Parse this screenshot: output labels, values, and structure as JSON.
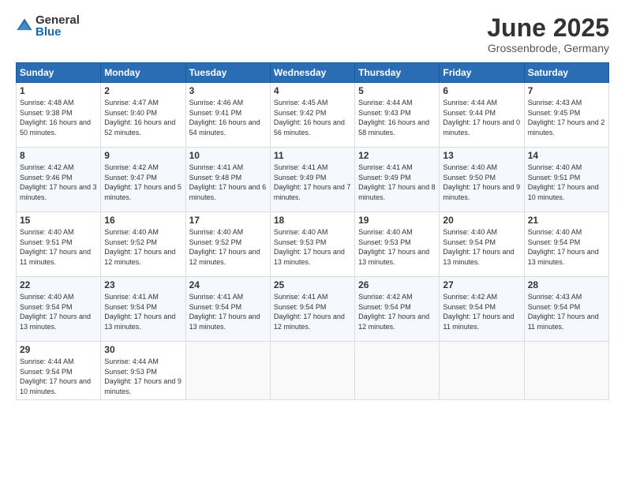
{
  "logo": {
    "general": "General",
    "blue": "Blue"
  },
  "title": "June 2025",
  "location": "Grossenbrode, Germany",
  "days": [
    "Sunday",
    "Monday",
    "Tuesday",
    "Wednesday",
    "Thursday",
    "Friday",
    "Saturday"
  ],
  "weeks": [
    [
      {
        "day": "1",
        "sunrise": "Sunrise: 4:48 AM",
        "sunset": "Sunset: 9:38 PM",
        "daylight": "Daylight: 16 hours and 50 minutes."
      },
      {
        "day": "2",
        "sunrise": "Sunrise: 4:47 AM",
        "sunset": "Sunset: 9:40 PM",
        "daylight": "Daylight: 16 hours and 52 minutes."
      },
      {
        "day": "3",
        "sunrise": "Sunrise: 4:46 AM",
        "sunset": "Sunset: 9:41 PM",
        "daylight": "Daylight: 16 hours and 54 minutes."
      },
      {
        "day": "4",
        "sunrise": "Sunrise: 4:45 AM",
        "sunset": "Sunset: 9:42 PM",
        "daylight": "Daylight: 16 hours and 56 minutes."
      },
      {
        "day": "5",
        "sunrise": "Sunrise: 4:44 AM",
        "sunset": "Sunset: 9:43 PM",
        "daylight": "Daylight: 16 hours and 58 minutes."
      },
      {
        "day": "6",
        "sunrise": "Sunrise: 4:44 AM",
        "sunset": "Sunset: 9:44 PM",
        "daylight": "Daylight: 17 hours and 0 minutes."
      },
      {
        "day": "7",
        "sunrise": "Sunrise: 4:43 AM",
        "sunset": "Sunset: 9:45 PM",
        "daylight": "Daylight: 17 hours and 2 minutes."
      }
    ],
    [
      {
        "day": "8",
        "sunrise": "Sunrise: 4:42 AM",
        "sunset": "Sunset: 9:46 PM",
        "daylight": "Daylight: 17 hours and 3 minutes."
      },
      {
        "day": "9",
        "sunrise": "Sunrise: 4:42 AM",
        "sunset": "Sunset: 9:47 PM",
        "daylight": "Daylight: 17 hours and 5 minutes."
      },
      {
        "day": "10",
        "sunrise": "Sunrise: 4:41 AM",
        "sunset": "Sunset: 9:48 PM",
        "daylight": "Daylight: 17 hours and 6 minutes."
      },
      {
        "day": "11",
        "sunrise": "Sunrise: 4:41 AM",
        "sunset": "Sunset: 9:49 PM",
        "daylight": "Daylight: 17 hours and 7 minutes."
      },
      {
        "day": "12",
        "sunrise": "Sunrise: 4:41 AM",
        "sunset": "Sunset: 9:49 PM",
        "daylight": "Daylight: 17 hours and 8 minutes."
      },
      {
        "day": "13",
        "sunrise": "Sunrise: 4:40 AM",
        "sunset": "Sunset: 9:50 PM",
        "daylight": "Daylight: 17 hours and 9 minutes."
      },
      {
        "day": "14",
        "sunrise": "Sunrise: 4:40 AM",
        "sunset": "Sunset: 9:51 PM",
        "daylight": "Daylight: 17 hours and 10 minutes."
      }
    ],
    [
      {
        "day": "15",
        "sunrise": "Sunrise: 4:40 AM",
        "sunset": "Sunset: 9:51 PM",
        "daylight": "Daylight: 17 hours and 11 minutes."
      },
      {
        "day": "16",
        "sunrise": "Sunrise: 4:40 AM",
        "sunset": "Sunset: 9:52 PM",
        "daylight": "Daylight: 17 hours and 12 minutes."
      },
      {
        "day": "17",
        "sunrise": "Sunrise: 4:40 AM",
        "sunset": "Sunset: 9:52 PM",
        "daylight": "Daylight: 17 hours and 12 minutes."
      },
      {
        "day": "18",
        "sunrise": "Sunrise: 4:40 AM",
        "sunset": "Sunset: 9:53 PM",
        "daylight": "Daylight: 17 hours and 13 minutes."
      },
      {
        "day": "19",
        "sunrise": "Sunrise: 4:40 AM",
        "sunset": "Sunset: 9:53 PM",
        "daylight": "Daylight: 17 hours and 13 minutes."
      },
      {
        "day": "20",
        "sunrise": "Sunrise: 4:40 AM",
        "sunset": "Sunset: 9:54 PM",
        "daylight": "Daylight: 17 hours and 13 minutes."
      },
      {
        "day": "21",
        "sunrise": "Sunrise: 4:40 AM",
        "sunset": "Sunset: 9:54 PM",
        "daylight": "Daylight: 17 hours and 13 minutes."
      }
    ],
    [
      {
        "day": "22",
        "sunrise": "Sunrise: 4:40 AM",
        "sunset": "Sunset: 9:54 PM",
        "daylight": "Daylight: 17 hours and 13 minutes."
      },
      {
        "day": "23",
        "sunrise": "Sunrise: 4:41 AM",
        "sunset": "Sunset: 9:54 PM",
        "daylight": "Daylight: 17 hours and 13 minutes."
      },
      {
        "day": "24",
        "sunrise": "Sunrise: 4:41 AM",
        "sunset": "Sunset: 9:54 PM",
        "daylight": "Daylight: 17 hours and 13 minutes."
      },
      {
        "day": "25",
        "sunrise": "Sunrise: 4:41 AM",
        "sunset": "Sunset: 9:54 PM",
        "daylight": "Daylight: 17 hours and 12 minutes."
      },
      {
        "day": "26",
        "sunrise": "Sunrise: 4:42 AM",
        "sunset": "Sunset: 9:54 PM",
        "daylight": "Daylight: 17 hours and 12 minutes."
      },
      {
        "day": "27",
        "sunrise": "Sunrise: 4:42 AM",
        "sunset": "Sunset: 9:54 PM",
        "daylight": "Daylight: 17 hours and 11 minutes."
      },
      {
        "day": "28",
        "sunrise": "Sunrise: 4:43 AM",
        "sunset": "Sunset: 9:54 PM",
        "daylight": "Daylight: 17 hours and 11 minutes."
      }
    ],
    [
      {
        "day": "29",
        "sunrise": "Sunrise: 4:44 AM",
        "sunset": "Sunset: 9:54 PM",
        "daylight": "Daylight: 17 hours and 10 minutes."
      },
      {
        "day": "30",
        "sunrise": "Sunrise: 4:44 AM",
        "sunset": "Sunset: 9:53 PM",
        "daylight": "Daylight: 17 hours and 9 minutes."
      },
      null,
      null,
      null,
      null,
      null
    ]
  ]
}
